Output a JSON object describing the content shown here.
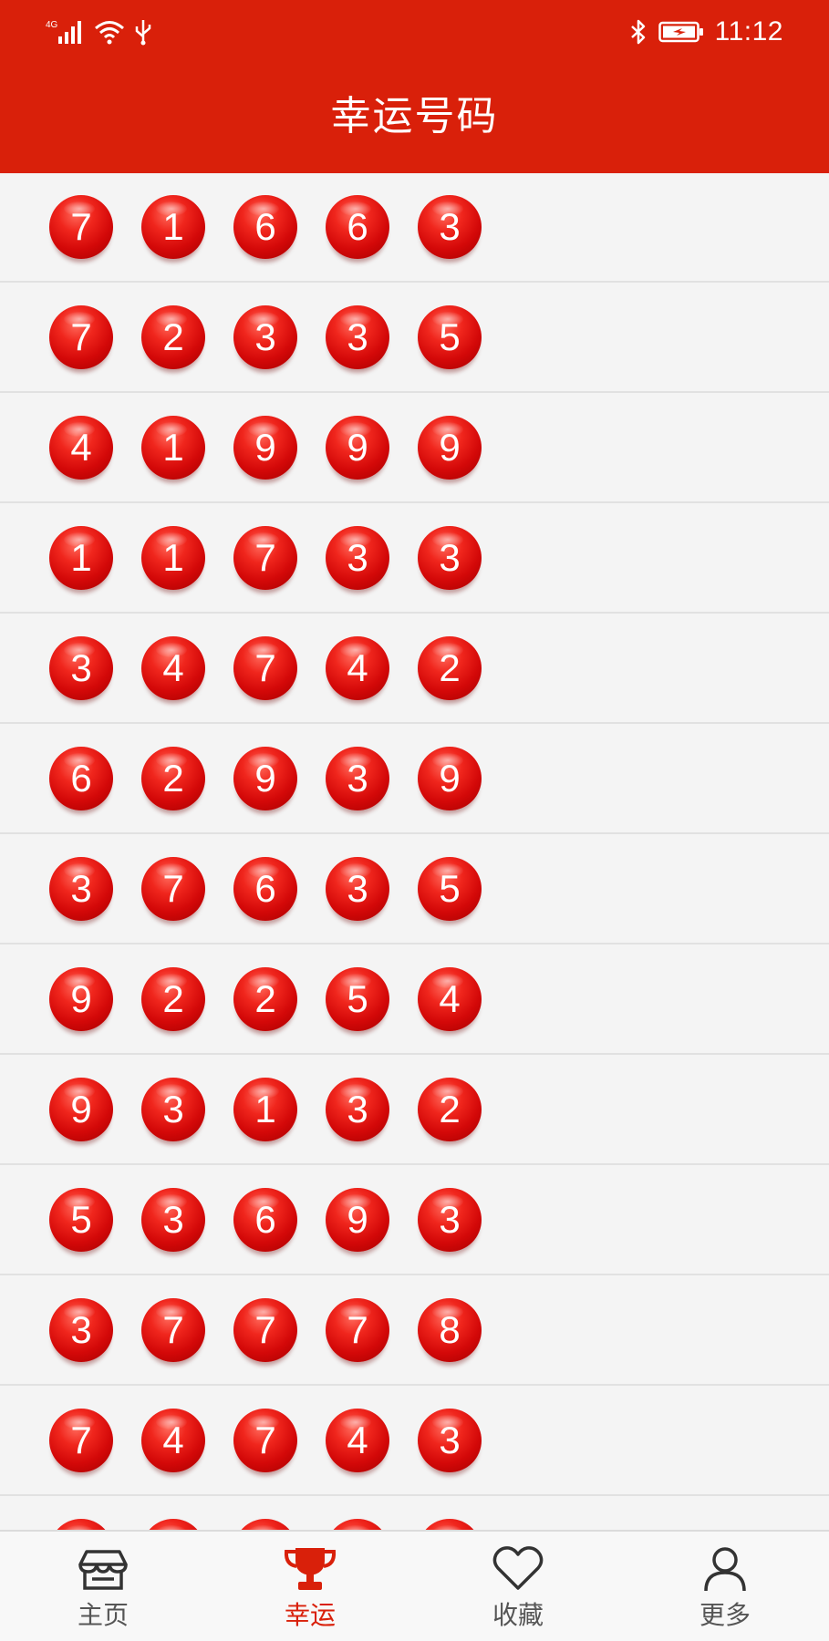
{
  "status_bar": {
    "network": "4G",
    "time": "11:12",
    "icons": [
      "signal-icon",
      "wifi-icon",
      "usb-icon",
      "bluetooth-icon",
      "battery-icon"
    ]
  },
  "header": {
    "title": "幸运号码"
  },
  "rows": [
    {
      "numbers": [
        "7",
        "1",
        "6",
        "6",
        "3"
      ]
    },
    {
      "numbers": [
        "7",
        "2",
        "3",
        "3",
        "5"
      ]
    },
    {
      "numbers": [
        "4",
        "1",
        "9",
        "9",
        "9"
      ]
    },
    {
      "numbers": [
        "1",
        "1",
        "7",
        "3",
        "3"
      ]
    },
    {
      "numbers": [
        "3",
        "4",
        "7",
        "4",
        "2"
      ]
    },
    {
      "numbers": [
        "6",
        "2",
        "9",
        "3",
        "9"
      ]
    },
    {
      "numbers": [
        "3",
        "7",
        "6",
        "3",
        "5"
      ]
    },
    {
      "numbers": [
        "9",
        "2",
        "2",
        "5",
        "4"
      ]
    },
    {
      "numbers": [
        "9",
        "3",
        "1",
        "3",
        "2"
      ]
    },
    {
      "numbers": [
        "5",
        "3",
        "6",
        "9",
        "3"
      ]
    },
    {
      "numbers": [
        "3",
        "7",
        "7",
        "7",
        "8"
      ]
    },
    {
      "numbers": [
        "7",
        "4",
        "7",
        "4",
        "3"
      ]
    },
    {
      "numbers": [
        "",
        "",
        "",
        "",
        ""
      ]
    }
  ],
  "nav": {
    "items": [
      {
        "label": "主页",
        "icon": "store-icon",
        "active": false
      },
      {
        "label": "幸运",
        "icon": "trophy-icon",
        "active": true
      },
      {
        "label": "收藏",
        "icon": "heart-icon",
        "active": false
      },
      {
        "label": "更多",
        "icon": "user-icon",
        "active": false
      }
    ]
  },
  "colors": {
    "accent": "#d9200a",
    "ball": "#e01010",
    "background": "#f4f4f4",
    "nav_text": "#555555"
  }
}
